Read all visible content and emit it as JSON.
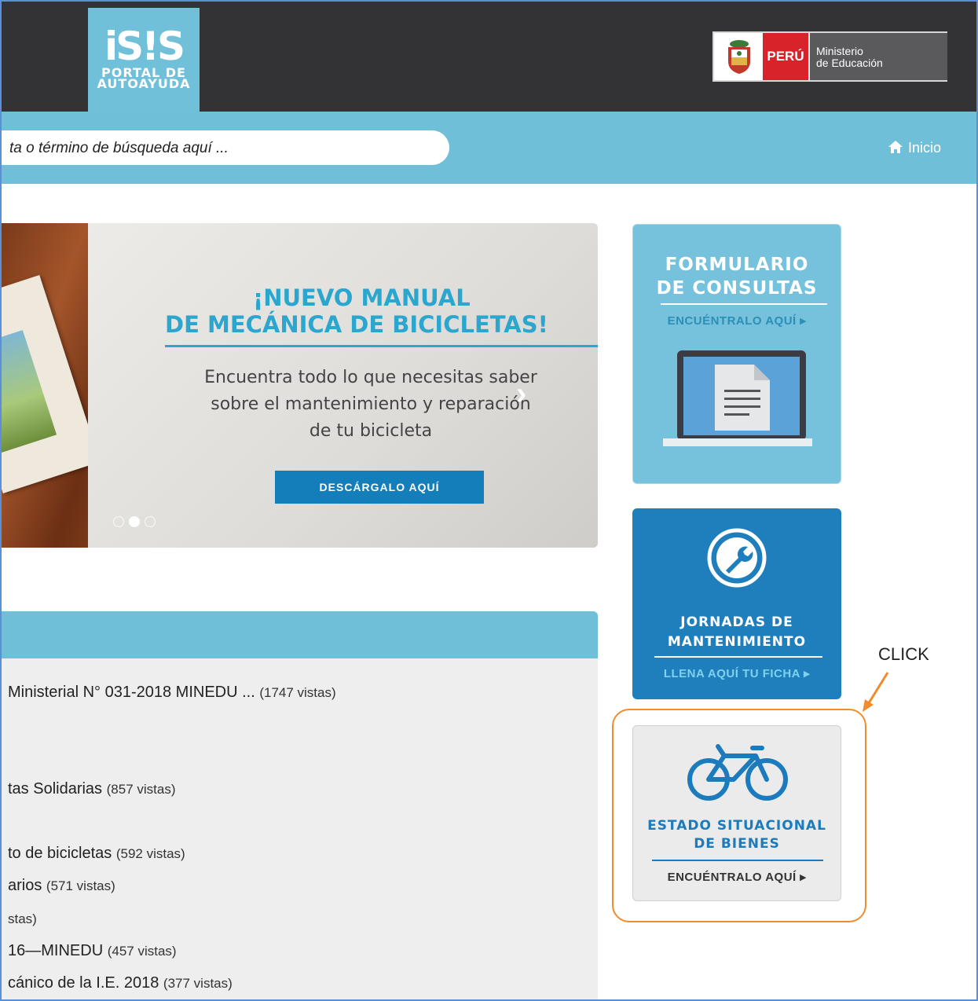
{
  "header": {
    "logo_text": "iS!S",
    "logo_sub1": "PORTAL DE",
    "logo_sub2": "AUTOAYUDA",
    "country_label": "PERÚ",
    "ministry_line1": "Ministerio",
    "ministry_line2": "de Educación"
  },
  "search": {
    "placeholder": "ta o término de búsqueda aquí ..."
  },
  "nav": {
    "home_label": "Inicio"
  },
  "slider": {
    "title_line1": "¡NUEVO MANUAL",
    "title_line2": "DE MECÁNICA DE BICICLETAS!",
    "description": "Encuentra todo lo que necesitas saber sobre el mantenimiento y reparación de tu bicicleta",
    "button_label": "DESCÁRGALO AQUÍ",
    "next_arrow": "›",
    "active_slide": 2,
    "slide_count": 3
  },
  "popular_list": [
    {
      "title": "Ministerial N° 031-2018 MINEDU ...",
      "views": "(1747 vistas)"
    },
    {
      "title": "tas Solidarias",
      "views": "(857 vistas)"
    },
    {
      "title": "to de bicicletas",
      "views": "(592 vistas)"
    },
    {
      "title": "arios",
      "views": "(571 vistas)"
    },
    {
      "title": "",
      "views": "stas)"
    },
    {
      "title": "16—MINEDU",
      "views": "(457 vistas)"
    },
    {
      "title": "cánico de la I.E. 2018",
      "views": "(377 vistas)"
    }
  ],
  "cards": {
    "consultas": {
      "title_line1": "FORMULARIO",
      "title_line2": "DE CONSULTAS",
      "link": "ENCUÉNTRALO AQUÍ ▸"
    },
    "mantenimiento": {
      "title_line1": "JORNADAS DE",
      "title_line2": "MANTENIMIENTO",
      "link": "LLENA AQUÍ TU FICHA ▸"
    },
    "bienes": {
      "title_line1": "ESTADO SITUACIONAL",
      "title_line2": "DE BIENES",
      "link": "ENCUÉNTRALO AQUÍ ▸"
    }
  },
  "annotation": {
    "label": "CLICK",
    "color": "#f08c2e"
  },
  "colors": {
    "header_bg": "#333335",
    "brand_light_blue": "#70bfd9",
    "brand_dark_blue": "#1f7fbc",
    "peru_red": "#d9232a"
  }
}
